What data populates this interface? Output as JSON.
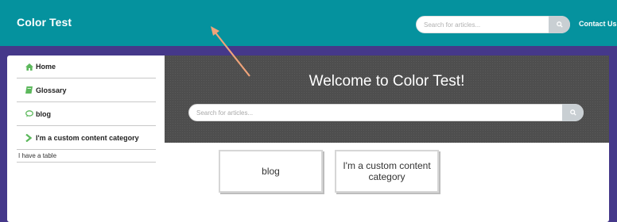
{
  "header": {
    "brand": "Color Test",
    "search_placeholder": "Search for articles...",
    "contact_label": "Contact Us"
  },
  "sidebar": {
    "items": [
      {
        "label": "Home",
        "icon": "home-icon"
      },
      {
        "label": "Glossary",
        "icon": "book-icon"
      },
      {
        "label": "blog",
        "icon": "chat-icon"
      },
      {
        "label": "I'm a custom content category",
        "icon": "chevron-right-icon"
      }
    ],
    "sub_items": [
      {
        "label": "I have a table"
      }
    ]
  },
  "hero": {
    "title": "Welcome to Color Test!",
    "search_placeholder": "Search for articles..."
  },
  "categories": [
    {
      "label": "blog"
    },
    {
      "label": "I'm a custom content category"
    }
  ],
  "colors": {
    "header_bg": "#05929e",
    "band_bg": "#45388a",
    "hero_bg": "#4e4e4e",
    "icon_green": "#5cb85c",
    "annotation_arrow": "#f0a47a"
  }
}
